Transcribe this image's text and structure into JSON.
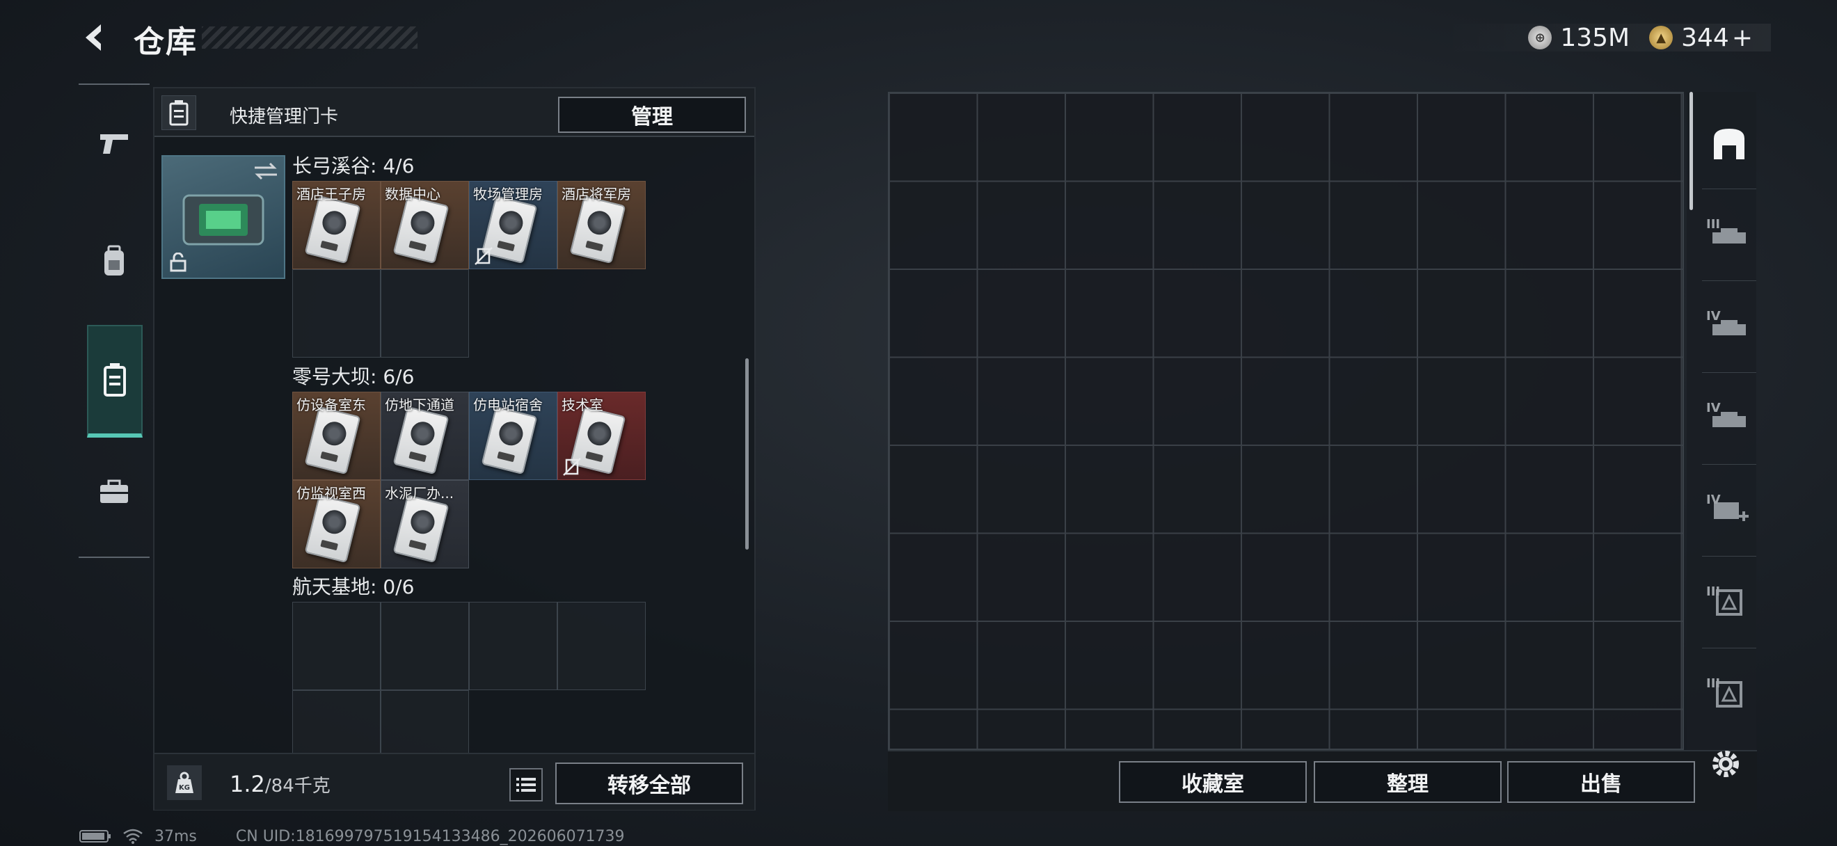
{
  "header": {
    "title": "仓库",
    "back_icon": "chevron-left-icon"
  },
  "currency": {
    "silver": {
      "icon": "silver-coin-icon",
      "value": "135M"
    },
    "gold": {
      "icon": "gold-coin-icon",
      "value": "344",
      "plus": "+"
    }
  },
  "side_nav": {
    "items": [
      {
        "icon": "pistol-icon",
        "active": false
      },
      {
        "icon": "backpack-icon",
        "active": false
      },
      {
        "icon": "keycard-case-icon",
        "active": true
      },
      {
        "icon": "toolbox-icon",
        "active": false
      }
    ]
  },
  "left_panel": {
    "header_label": "快捷管理门卡",
    "manage_label": "管理",
    "sections": [
      {
        "title": "长弓溪谷: 4/6",
        "cards": [
          {
            "name": "酒店王子房",
            "rarity": "brown",
            "tag": false
          },
          {
            "name": "数据中心",
            "rarity": "brown",
            "tag": false
          },
          {
            "name": "牧场管理房",
            "rarity": "blue",
            "tag": true
          },
          {
            "name": "酒店将军房",
            "rarity": "brown",
            "tag": false
          }
        ]
      },
      {
        "title": "零号大坝: 6/6",
        "cards": [
          {
            "name": "仿设备室东",
            "rarity": "brown",
            "tag": false
          },
          {
            "name": "仿地下通道",
            "rarity": "dark",
            "tag": false
          },
          {
            "name": "仿电站宿舍",
            "rarity": "blue",
            "tag": false
          },
          {
            "name": "技术室",
            "rarity": "red",
            "tag": true
          },
          {
            "name": "仿监视室西",
            "rarity": "brown",
            "tag": false
          },
          {
            "name": "水泥厂办...",
            "rarity": "dark",
            "tag": false
          }
        ]
      },
      {
        "title": "航天基地: 0/6",
        "cards": []
      }
    ],
    "footer": {
      "weight_current": "1.2",
      "weight_total": "/84千克",
      "kg_icon": "weight-kg-icon",
      "list_icon": "list-icon",
      "transfer_label": "转移全部"
    }
  },
  "storage_footer": {
    "collection_label": "收藏室",
    "sort_label": "整理",
    "sell_label": "出售"
  },
  "right_tabs": [
    {
      "icon": "storage-home-icon",
      "roman": ""
    },
    {
      "icon": "container-icon",
      "roman": "III"
    },
    {
      "icon": "container-icon",
      "roman": "IV"
    },
    {
      "icon": "container-icon",
      "roman": "IV"
    },
    {
      "icon": "medical-container-icon",
      "roman": "IV"
    },
    {
      "icon": "marked-container-icon",
      "roman": "III"
    },
    {
      "icon": "marked-container-icon",
      "roman": "III"
    }
  ],
  "status_bar": {
    "battery_icon": "battery-icon",
    "wifi_icon": "wifi-icon",
    "ping": "37ms",
    "uid": "CN UID:1816997975191541334​86_202606071739"
  }
}
